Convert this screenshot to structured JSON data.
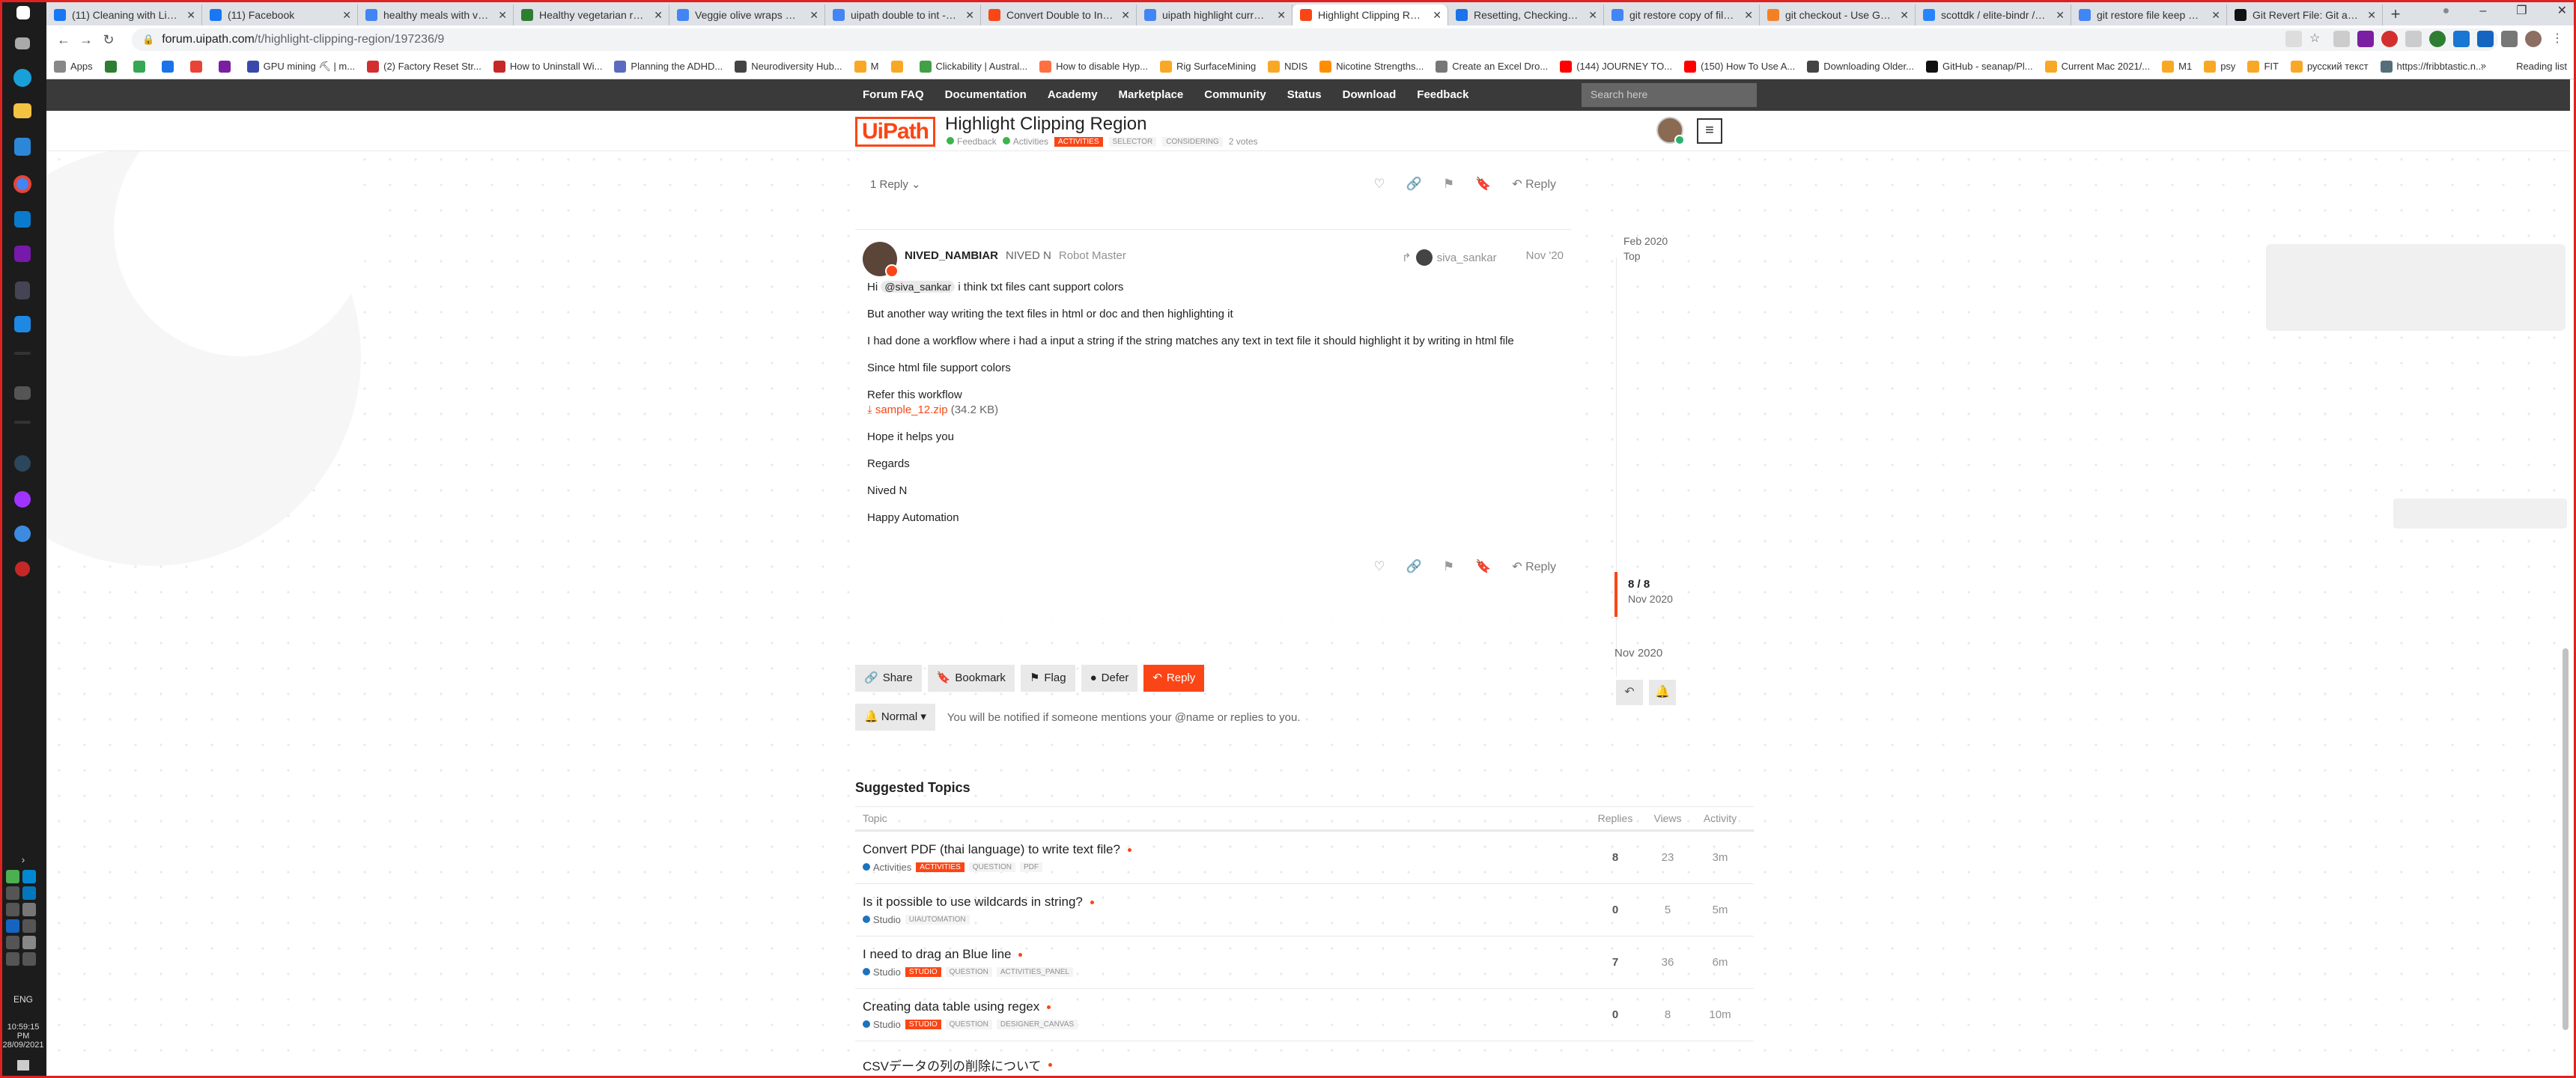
{
  "browser": {
    "tabs": [
      {
        "title": "(11) Cleaning with Liz | Face",
        "color": "#1877f2"
      },
      {
        "title": "(11) Facebook",
        "color": "#1877f2"
      },
      {
        "title": "healthy meals with vegetables",
        "color": "#4285f4"
      },
      {
        "title": "Healthy vegetarian recipes",
        "color": "#2e7d32"
      },
      {
        "title": "Veggie olive wraps with m",
        "color": "#4285f4"
      },
      {
        "title": "uipath double to int - Goo",
        "color": "#4285f4"
      },
      {
        "title": "Convert Double to Integer",
        "color": "#fa4616"
      },
      {
        "title": "uipath highlight current m",
        "color": "#4285f4"
      },
      {
        "title": "Highlight Clipping Region",
        "color": "#fa4616"
      },
      {
        "title": "Resetting, Checking Out &",
        "color": "#1a73e8"
      },
      {
        "title": "git restore copy of file kee",
        "color": "#4285f4"
      },
      {
        "title": "git checkout - Use Git to m",
        "color": "#f48024"
      },
      {
        "title": "scottdk / elite-bindr / Bran",
        "color": "#2684ff"
      },
      {
        "title": "git restore file keep curren",
        "color": "#4285f4"
      },
      {
        "title": "Git Revert File: Git and Git",
        "color": "#111111"
      }
    ],
    "active_tab_index": 8,
    "url_host": "forum.uipath.com",
    "url_path": "/t/highlight-clipping-region/197236/9",
    "bookmarks": [
      "Apps",
      "",
      "",
      "",
      "",
      "",
      "GPU mining ⛏ | m...",
      "(2) Factory Reset Str...",
      "How to Uninstall Wi...",
      "Planning the ADHD...",
      "Neurodiversity Hub...",
      "M",
      "",
      "Clickability | Austral...",
      "How to disable Hyp...",
      "Rig SurfaceMining",
      "NDIS",
      "Nicotine Strengths...",
      "Create an Excel Dro...",
      "(144) JOURNEY TO...",
      "(150) How To Use A...",
      "Downloading Older...",
      "GitHub - seanap/Pl...",
      "Current Mac 2021/...",
      "M1",
      "psy",
      "FIT",
      "русский текст",
      "https://fribbtastic.n..."
    ],
    "reading_list": "Reading list"
  },
  "taskbar": {
    "lang": "ENG",
    "time": "10:59:15 PM",
    "date": "28/09/2021"
  },
  "forum": {
    "nav_links": [
      "Forum FAQ",
      "Documentation",
      "Academy",
      "Marketplace",
      "Community",
      "Status",
      "Download",
      "Feedback"
    ],
    "search_placeholder": "Search here",
    "logo_text": "UiPath",
    "topic_title": "Highlight Clipping Region",
    "meta": {
      "category": "Feedback",
      "subcategory": "Activities",
      "tags": [
        "ACTIVITIES",
        "SELECTOR",
        "CONSIDERING"
      ],
      "votes": "2 votes"
    },
    "prev_post": {
      "replies": "1 Reply",
      "reply_label": "Reply"
    },
    "post": {
      "username": "NIVED_NAMBIAR",
      "fullname": "NIVED N",
      "user_title": "Robot Master",
      "reply_to": "siva_sankar",
      "date": "Nov '20",
      "mention": "@siva_sankar",
      "p1_rest": " i think txt files cant support colors",
      "p2": "But another way writing the text files in html or doc and then highlighting it",
      "p3": "I had done a workflow where i had a input a string if the string matches any text in text file it should highlight it by writing in html file",
      "p4": "Since html file support colors",
      "p5": "Refer this workflow",
      "attachment": "sample_12.zip",
      "attachment_size": "(34.2 KB)",
      "p6": "Hope it helps you",
      "p7": "Regards",
      "p8": "Nived N",
      "p9": "Happy Automation",
      "reply_label": "Reply"
    },
    "timeline": {
      "start_date": "Feb 2020",
      "start_label": "Top",
      "position": "8 / 8",
      "position_date": "Nov 2020",
      "end_date": "Nov 2020"
    },
    "footer_buttons": {
      "share": "Share",
      "bookmark": "Bookmark",
      "flag": "Flag",
      "defer": "Defer",
      "reply": "Reply"
    },
    "notification": {
      "level": "Normal",
      "text": "You will be notified if someone mentions your @name or replies to you."
    },
    "suggested": {
      "heading": "Suggested Topics",
      "columns": [
        "Topic",
        "Replies",
        "Views",
        "Activity"
      ],
      "rows": [
        {
          "title": "Convert PDF (thai language) to write text file?",
          "category": "Activities",
          "cat_color": "#1e73be",
          "tags": [
            "ACTIVITIES",
            "QUESTION",
            "PDF"
          ],
          "replies": "8",
          "views": "23",
          "activity": "3m"
        },
        {
          "title": "Is it possible to use wildcards in string?",
          "category": "Studio",
          "cat_color": "#1e73be",
          "tags": [
            "UIAUTOMATION"
          ],
          "replies": "0",
          "views": "5",
          "activity": "5m"
        },
        {
          "title": "I need to drag an Blue line",
          "category": "Studio",
          "cat_color": "#1e73be",
          "tags": [
            "STUDIO",
            "QUESTION",
            "ACTIVITIES_PANEL"
          ],
          "replies": "7",
          "views": "36",
          "activity": "6m"
        },
        {
          "title": "Creating data table using regex",
          "category": "Studio",
          "cat_color": "#1e73be",
          "tags": [
            "STUDIO",
            "QUESTION",
            "DESIGNER_CANVAS"
          ],
          "replies": "0",
          "views": "8",
          "activity": "10m"
        },
        {
          "title": "CSVデータの列の削除について",
          "category": "",
          "cat_color": "#1e73be",
          "tags": [],
          "replies": "",
          "views": "",
          "activity": ""
        }
      ]
    }
  },
  "colors": {
    "accent": "#fa4616",
    "topnav": "#3a3a3a",
    "category_blue": "#1e73be",
    "tag_green": "#3ab54a"
  }
}
